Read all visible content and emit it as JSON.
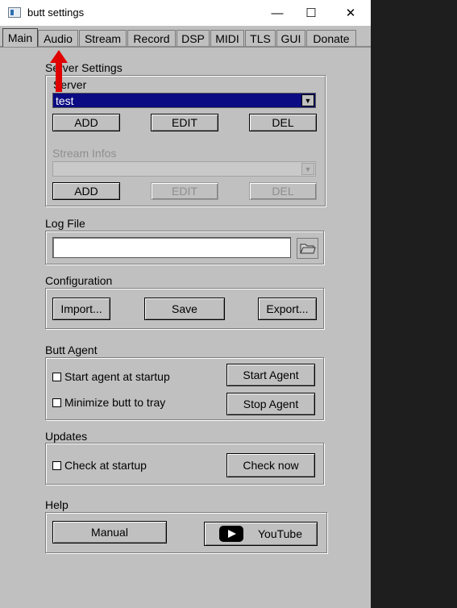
{
  "window": {
    "title": "butt settings",
    "minimize": "—",
    "maximize": "☐",
    "close": "✕"
  },
  "tabs": [
    "Main",
    "Audio",
    "Stream",
    "Record",
    "DSP",
    "MIDI",
    "TLS",
    "GUI",
    "Donate"
  ],
  "server_settings": {
    "label": "Server Settings",
    "server_label": "Server",
    "server_value": "test",
    "add": "ADD",
    "edit": "EDIT",
    "del": "DEL",
    "stream_infos_label": "Stream Infos",
    "info_add": "ADD",
    "info_edit": "EDIT",
    "info_del": "DEL"
  },
  "log_file": {
    "label": "Log File",
    "value": ""
  },
  "configuration": {
    "label": "Configuration",
    "import": "Import...",
    "save": "Save",
    "export": "Export..."
  },
  "butt_agent": {
    "label": "Butt Agent",
    "start_at_startup": "Start agent at startup",
    "minimize_to_tray": "Minimize butt to tray",
    "start_agent": "Start Agent",
    "stop_agent": "Stop Agent"
  },
  "updates": {
    "label": "Updates",
    "check_at_startup": "Check at startup",
    "check_now": "Check now"
  },
  "help": {
    "label": "Help",
    "manual": "Manual",
    "youtube": "YouTube"
  },
  "colors": {
    "window_bg": "#c0c0c0",
    "selection": "#0b0b83",
    "annotation_arrow": "#e00000"
  },
  "icons": {
    "app": "butt-app-icon",
    "folder": "folder-icon",
    "youtube": "youtube-logo-icon",
    "arrow": "red-arrow-icon"
  }
}
